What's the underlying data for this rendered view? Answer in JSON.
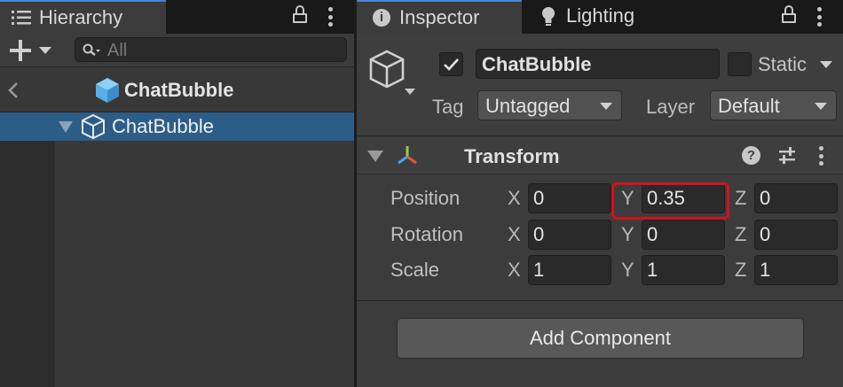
{
  "hierarchy": {
    "tab_title": "Hierarchy",
    "search_placeholder": "All",
    "scene_title": "ChatBubble",
    "selected_item": "ChatBubble"
  },
  "inspector": {
    "tabs": [
      "Inspector",
      "Lighting"
    ],
    "object_name": "ChatBubble",
    "active_checked": true,
    "static_label": "Static",
    "tag_label": "Tag",
    "tag_value": "Untagged",
    "layer_label": "Layer",
    "layer_value": "Default",
    "component": {
      "title": "Transform",
      "rows": [
        {
          "label": "Position",
          "x": "0",
          "y": "0.35",
          "z": "0"
        },
        {
          "label": "Rotation",
          "x": "0",
          "y": "0",
          "z": "0"
        },
        {
          "label": "Scale",
          "x": "1",
          "y": "1",
          "z": "1"
        }
      ],
      "axes": [
        "X",
        "Y",
        "Z"
      ]
    },
    "add_component_label": "Add Component"
  },
  "colors": {
    "selection": "#2c5d87",
    "tab_accent": "#4a86d0",
    "highlight_border": "#d4101a",
    "cube_icon": "#5aaee6"
  },
  "icons": [
    "list-icon",
    "lock-icon",
    "menu-kebab-icon",
    "plus-icon",
    "search-icon",
    "back-chevron-icon",
    "cube-icon",
    "info-icon",
    "lightbulb-icon",
    "checkmark-icon",
    "gameobject-cube-icon",
    "transform-axis-icon",
    "help-icon",
    "preset-sliders-icon"
  ]
}
